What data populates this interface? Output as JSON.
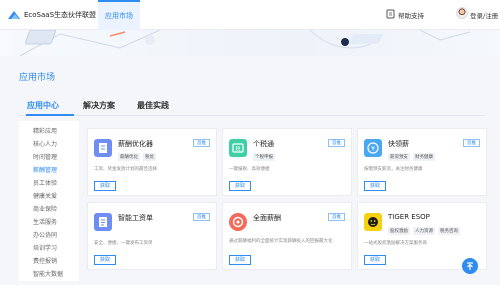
{
  "header": {
    "logo_text": "EcoSaaS生态伙伴联盟",
    "nav_tab": "应用市场",
    "help": "帮助支持",
    "login": "登录/注册"
  },
  "page_title": "应用市场",
  "tabs": [
    {
      "label": "应用中心",
      "active": true
    },
    {
      "label": "解决方案",
      "active": false
    },
    {
      "label": "最佳实践",
      "active": false
    }
  ],
  "sidebar": {
    "items": [
      {
        "label": "精彩应用",
        "active": false
      },
      {
        "label": "核心人力",
        "active": false
      },
      {
        "label": "时间管理",
        "active": false
      },
      {
        "label": "薪酬管理",
        "active": true
      },
      {
        "label": "员工体验",
        "active": false
      },
      {
        "label": "健康关爱",
        "active": false
      },
      {
        "label": "商业保险",
        "active": false
      },
      {
        "label": "生活服务",
        "active": false
      },
      {
        "label": "办公协同",
        "active": false
      },
      {
        "label": "培训学习",
        "active": false
      },
      {
        "label": "费控报销",
        "active": false
      },
      {
        "label": "智能大数据",
        "active": false
      }
    ]
  },
  "cards": [
    {
      "name": "薪酬优化器",
      "tags": [
        "薪酬优化",
        "税优"
      ],
      "badge": "首推",
      "desc": "工资、奖金发放计划的最佳选择",
      "button": "获取",
      "icon": "doc-icon",
      "icon_color": "#6f8df2"
    },
    {
      "name": "个税通",
      "tags": [
        "个税申报"
      ],
      "badge": "首推",
      "desc": "一键报税、高效便捷",
      "button": "获取",
      "icon": "tax-icon",
      "icon_color": "#3fcfa6"
    },
    {
      "name": "快领薪",
      "tags": [
        "薪资预支",
        "财务健康"
      ],
      "badge": "首推",
      "desc": "按需预支薪资，关注财务健康",
      "button": "获取",
      "icon": "money-icon",
      "icon_color": "#4aa8f2"
    },
    {
      "name": "智能工资单",
      "tags": [],
      "badge": "首推",
      "desc": "安全、便捷、一键发布工资单",
      "button": "获取",
      "icon": "payslip-icon",
      "icon_color": "#6f8df2"
    },
    {
      "name": "全面薪酬",
      "tags": [],
      "badge": "首推",
      "desc": "通过薪酬福利的全面统计实现薪酬投入的回报最大化",
      "button": "获取",
      "icon": "compass-icon",
      "icon_color": "#f26b5b"
    },
    {
      "name": "TIGER ESOP",
      "tags": [
        "股权激励",
        "人力资源",
        "税务咨询"
      ],
      "badge": "首推",
      "desc": "一站式股权激励解决方案服务商",
      "button": "获取",
      "icon": "tiger-icon",
      "icon_color": "#f5d20f"
    }
  ],
  "colors": {
    "accent": "#2f8cf0"
  }
}
